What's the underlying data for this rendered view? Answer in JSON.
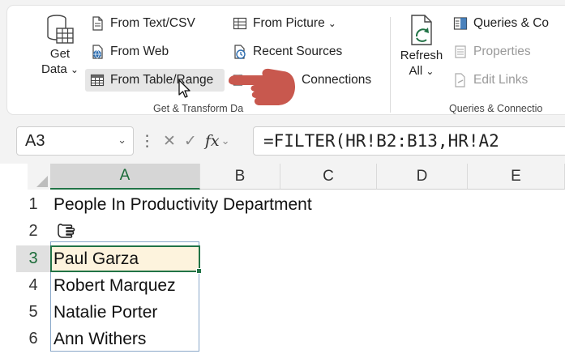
{
  "ribbon": {
    "get_data": {
      "line1": "Get",
      "line2": "Data",
      "chevron": "⌄"
    },
    "buttons": {
      "from_text_csv": "From Text/CSV",
      "from_web": "From Web",
      "from_table_range": "From Table/Range",
      "from_picture": "From Picture",
      "recent_sources": "Recent Sources",
      "existing_connections": "Connections"
    },
    "chevron": "⌄",
    "group_label_get_transform": "Get & Transform Da",
    "refresh_all": {
      "line1": "Refresh",
      "line2": "All",
      "chevron": "⌄"
    },
    "queries": {
      "queries_connections": "Queries & Co",
      "properties": "Properties",
      "edit_links": "Edit Links"
    },
    "group_label_queries": "Queries & Connectio"
  },
  "formula_bar": {
    "name_box": "A3",
    "chevron": "⌄",
    "separator": "⋮",
    "cancel": "✕",
    "enter": "✓",
    "fx": "fx",
    "formula": "=FILTER(HR!B2:B13,HR!A2"
  },
  "grid": {
    "columns": [
      "A",
      "B",
      "C",
      "D",
      "E"
    ],
    "rows": [
      "1",
      "2",
      "3",
      "4",
      "5",
      "6"
    ],
    "cells": {
      "a1": "People In Productivity Department",
      "a3": "Paul Garza",
      "a4": "Robert Marquez",
      "a5": "Natalie Porter",
      "a6": "Ann Withers"
    }
  },
  "colors": {
    "accent_green": "#217346",
    "pointer_red": "#c8584e",
    "selection_fill": "#fdf3dd"
  },
  "icons": [
    "database-table-icon",
    "text-file-icon",
    "web-file-icon",
    "table-range-icon",
    "picture-table-icon",
    "recent-sources-icon",
    "connections-icon",
    "refresh-icon",
    "queries-icon",
    "properties-icon",
    "edit-links-icon",
    "pointing-hand-icon",
    "mouse-cursor-icon"
  ]
}
